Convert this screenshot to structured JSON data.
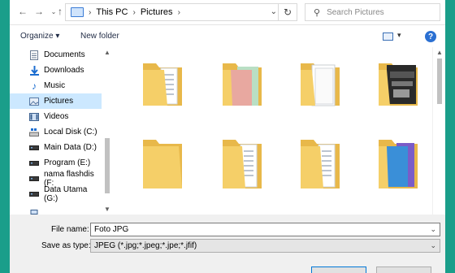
{
  "address": {
    "crumbs": [
      "This PC",
      "Pictures"
    ],
    "search_placeholder": "Search Pictures"
  },
  "toolbar": {
    "organize_label": "Organize ▾",
    "new_folder_label": "New folder"
  },
  "nav": {
    "items": [
      {
        "label": "Documents",
        "icon": "document-icon"
      },
      {
        "label": "Downloads",
        "icon": "download-icon"
      },
      {
        "label": "Music",
        "icon": "music-icon"
      },
      {
        "label": "Pictures",
        "icon": "pictures-icon",
        "selected": true
      },
      {
        "label": "Videos",
        "icon": "video-icon"
      },
      {
        "label": "Local Disk (C:)",
        "icon": "drive-icon"
      },
      {
        "label": "Main Data (D:)",
        "icon": "drive-icon"
      },
      {
        "label": "Program (E:)",
        "icon": "drive-icon"
      },
      {
        "label": "nama flashdis (F:",
        "icon": "drive-icon"
      },
      {
        "label": "Data Utama (G:)",
        "icon": "drive-icon"
      }
    ]
  },
  "save": {
    "filename_label": "File name:",
    "filename_value": "Foto JPG",
    "type_label": "Save as type:",
    "type_value": "JPEG (*.jpg;*.jpeg;*.jpe;*.jfif)"
  },
  "colors": {
    "accent": "#0078d7",
    "folder": "#f5cf68",
    "background": "#1a9e8a"
  }
}
